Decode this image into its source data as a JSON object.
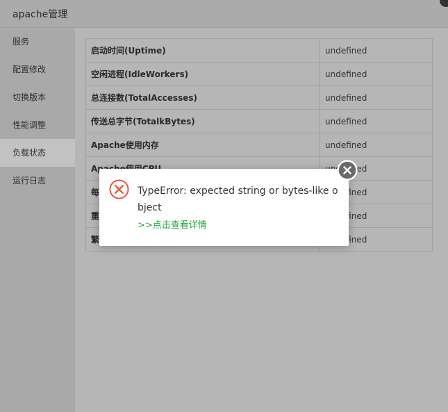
{
  "window": {
    "title": "apache管理"
  },
  "sidebar": {
    "items": [
      {
        "label": "服务"
      },
      {
        "label": "配置修改"
      },
      {
        "label": "切换版本"
      },
      {
        "label": "性能调整"
      },
      {
        "label": "负载状态",
        "active": true
      },
      {
        "label": "运行日志"
      }
    ]
  },
  "table": {
    "rows": [
      {
        "key": "启动时间(Uptime)",
        "value": "undefined"
      },
      {
        "key": "空闲进程(IdleWorkers)",
        "value": "undefined"
      },
      {
        "key": "总连接数(TotalAccesses)",
        "value": "undefined"
      },
      {
        "key": "传送总字节(TotalkBytes)",
        "value": "undefined"
      },
      {
        "key": "Apache使用内存",
        "value": "undefined"
      },
      {
        "key": "Apache使用CPU",
        "value": "undefined"
      },
      {
        "key": "每",
        "value": "undefined"
      },
      {
        "key": "重",
        "value": "undefined"
      },
      {
        "key": "繁",
        "value": "undefined"
      }
    ]
  },
  "dialog": {
    "icon": "error-circle-icon",
    "message": "TypeError: expected string or bytes-like object",
    "detail_link": ">>点击查看详情"
  },
  "colors": {
    "error": "#e6553b",
    "link": "#20a53a",
    "close": "#6a6a6a"
  }
}
